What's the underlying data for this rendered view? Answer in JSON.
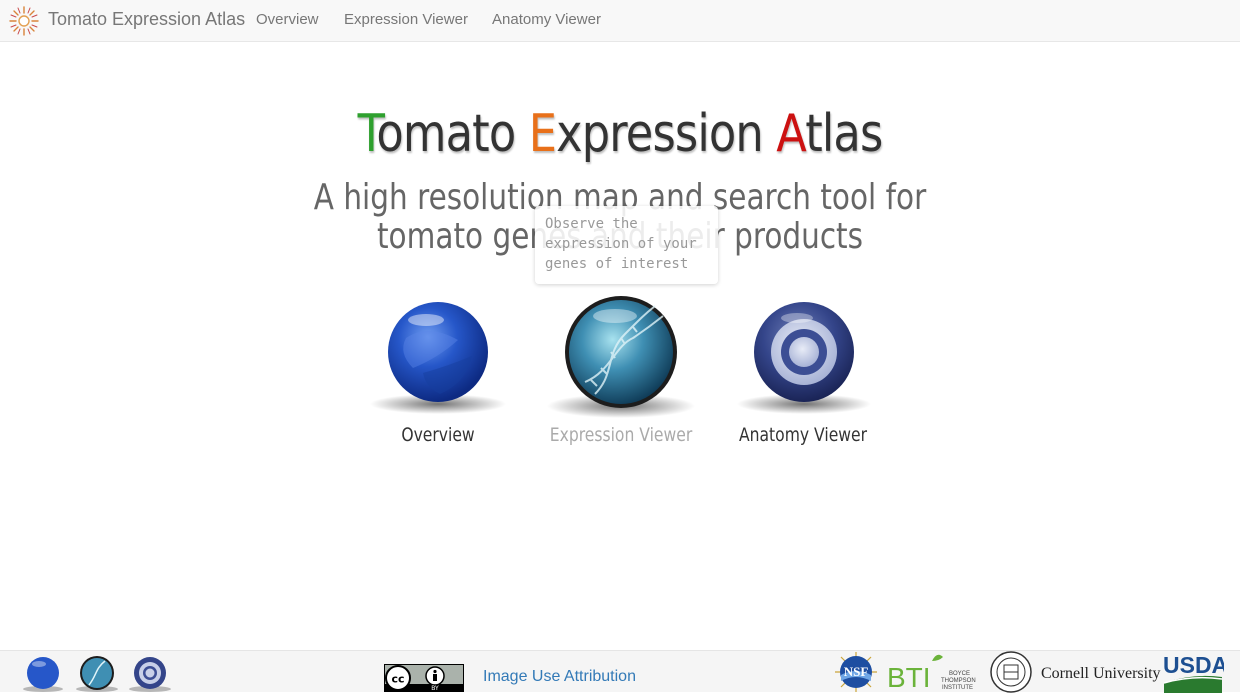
{
  "navbar": {
    "brand": "Tomato Expression Atlas",
    "links": [
      "Overview",
      "Expression Viewer",
      "Anatomy Viewer"
    ]
  },
  "hero": {
    "title_parts": [
      {
        "initial": "T",
        "rest": "omato",
        "color": "#2ea02e"
      },
      {
        "initial": "E",
        "rest": "xpression",
        "color": "#e8701a"
      },
      {
        "initial": "A",
        "rest": "tlas",
        "color": "#cc1111"
      }
    ],
    "subtitle_line1": "A high resolution map and search tool for",
    "subtitle_line2": "tomato genes and their products"
  },
  "tooltip": {
    "text_line1": "Observe the",
    "text_line2": "expression of your",
    "text_line3": "genes of interest"
  },
  "tools": [
    {
      "label": "Overview",
      "icon": "blue-sphere-icon"
    },
    {
      "label": "Expression Viewer",
      "icon": "dna-sphere-icon"
    },
    {
      "label": "Anatomy Viewer",
      "icon": "target-sphere-icon"
    }
  ],
  "footer": {
    "license_badge": "cc-by-icon",
    "license_badge_text": "BY",
    "attribution": "Image Use Attribution",
    "sponsors": {
      "nsf": "NSF",
      "bti": "BTI",
      "bti_sub1": "BOYCE",
      "bti_sub2": "THOMPSON",
      "bti_sub3": "INSTITUTE",
      "cornell": "Cornell University",
      "usda": "USDA"
    }
  },
  "colors": {
    "accent_link": "#337ab7",
    "navbar_bg": "#f8f8f8"
  }
}
